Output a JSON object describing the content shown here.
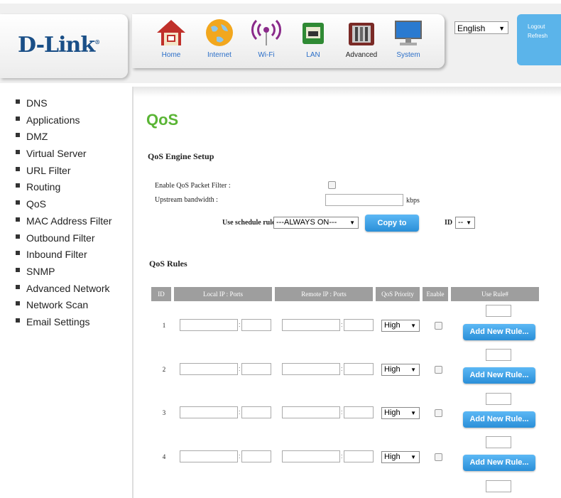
{
  "header": {
    "logo_text": "D-Link",
    "logo_mark": "®",
    "nav": [
      {
        "label": "Home",
        "icon": "home-icon"
      },
      {
        "label": "Internet",
        "icon": "globe-icon"
      },
      {
        "label": "Wi-Fi",
        "icon": "wifi-icon"
      },
      {
        "label": "LAN",
        "icon": "lan-icon"
      },
      {
        "label": "Advanced",
        "icon": "tools-icon",
        "active": true
      },
      {
        "label": "System",
        "icon": "monitor-icon"
      }
    ],
    "language": "English",
    "logout": "Logout",
    "refresh": "Refresh"
  },
  "sidebar": {
    "items": [
      "DNS",
      "Applications",
      "DMZ",
      "Virtual Server",
      "URL Filter",
      "Routing",
      "QoS",
      "MAC Address Filter",
      "Outbound Filter",
      "Inbound Filter",
      "SNMP",
      "Advanced Network",
      "Network Scan",
      "Email Settings"
    ]
  },
  "page": {
    "title": "QoS",
    "engine": {
      "heading": "QoS Engine Setup",
      "enable_label": "Enable QoS Packet Filter :",
      "enable_checked": false,
      "upstream_label": "Upstream bandwidth :",
      "upstream_value": "",
      "unit": "kbps",
      "schedule_label": "Use schedule rule",
      "schedule_value": "---ALWAYS ON---",
      "copy_button": "Copy to",
      "id_label": "ID",
      "id_value": "--"
    },
    "rules": {
      "heading": "QoS Rules",
      "columns": [
        "ID",
        "Local IP : Ports",
        "Remote IP : Ports",
        "QoS Priority",
        "Enable",
        "Use Rule#"
      ],
      "rows": [
        {
          "id": "1",
          "priority": "High",
          "button": "Add New Rule..."
        },
        {
          "id": "2",
          "priority": "High",
          "button": "Add New Rule..."
        },
        {
          "id": "3",
          "priority": "High",
          "button": "Add New Rule..."
        },
        {
          "id": "4",
          "priority": "High",
          "button": "Add New Rule..."
        }
      ]
    }
  },
  "colors": {
    "title_green": "#5ab535",
    "nav_blue": "#2a6ec8",
    "button_blue": "#3da3ea",
    "table_header": "#9e9e9e",
    "logo_blue": "#1a4f87"
  }
}
